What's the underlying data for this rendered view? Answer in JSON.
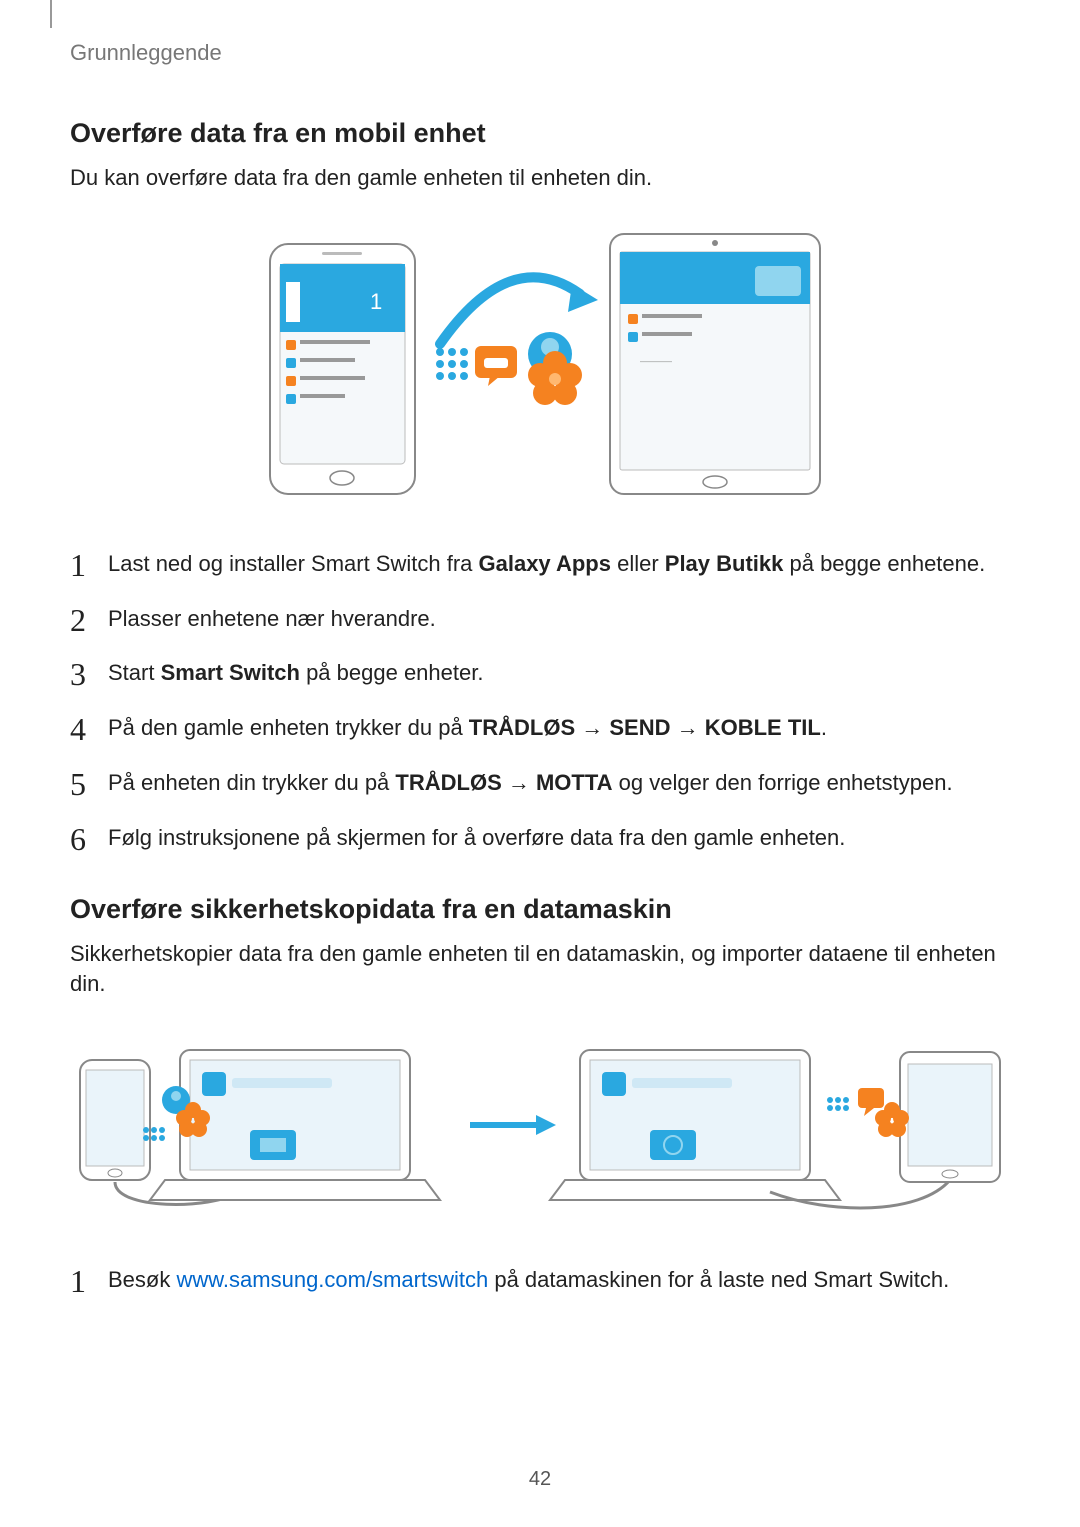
{
  "breadcrumb": "Grunnleggende",
  "section1": {
    "heading": "Overføre data fra en mobil enhet",
    "intro": "Du kan overføre data fra den gamle enheten til enheten din.",
    "steps": {
      "s1_a": "Last ned og installer Smart Switch fra ",
      "s1_b": "Galaxy Apps",
      "s1_c": " eller ",
      "s1_d": "Play Butikk",
      "s1_e": " på begge enhetene.",
      "s2": "Plasser enhetene nær hverandre.",
      "s3_a": "Start ",
      "s3_b": "Smart Switch",
      "s3_c": " på begge enheter.",
      "s4_a": "På den gamle enheten trykker du på ",
      "s4_b": "TRÅDLØS",
      "s4_c": "SEND",
      "s4_d": "KOBLE TIL",
      "s5_a": "På enheten din trykker du på ",
      "s5_b": "TRÅDLØS",
      "s5_c": "MOTTA",
      "s5_d": " og velger den forrige enhetstypen.",
      "s6": "Følg instruksjonene på skjermen for å overføre data fra den gamle enheten."
    }
  },
  "section2": {
    "heading": "Overføre sikkerhetskopidata fra en datamaskin",
    "intro": "Sikkerhetskopier data fra den gamle enheten til en datamaskin, og importer dataene til enheten din.",
    "steps": {
      "s1_a": "Besøk ",
      "s1_link": "www.samsung.com/smartswitch",
      "s1_b": " på datamaskinen for å laste ned Smart Switch."
    },
    "link_href": "http://www.samsung.com/smartswitch"
  },
  "arrow": " → ",
  "period": ".",
  "page_number": "42"
}
